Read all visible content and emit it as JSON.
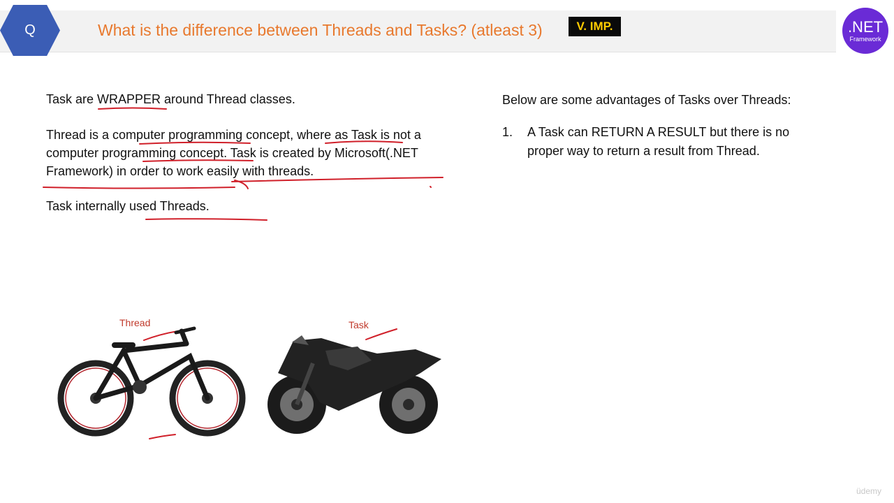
{
  "header": {
    "badge_label": "Q",
    "title": "What is the difference between Threads and Tasks? (atleast 3)",
    "imp_badge": "V. IMP.",
    "logo_main": ".NET",
    "logo_sub": "Framework"
  },
  "left": {
    "para1": "Task are WRAPPER around Thread classes.",
    "para2": "Thread is a computer programming concept, where as Task is not a computer programming concept. Task is created by Microsoft(.NET Framework) in order to work easily with threads.",
    "para3": "Task internally used Threads."
  },
  "images": {
    "thread_label": "Thread",
    "task_label": "Task"
  },
  "right": {
    "heading": "Below are some advantages of Tasks over Threads:",
    "items": [
      {
        "num": "1.",
        "text": "A Task can RETURN A RESULT but there is no proper way to return a result from Thread."
      }
    ]
  },
  "watermark": "üdemy",
  "colors": {
    "title": "#e8792e",
    "q_badge": "#3b5db5",
    "imp_text": "#ffcc00",
    "net_logo": "#6a2bd6",
    "annotation_pen": "#d0202a"
  }
}
